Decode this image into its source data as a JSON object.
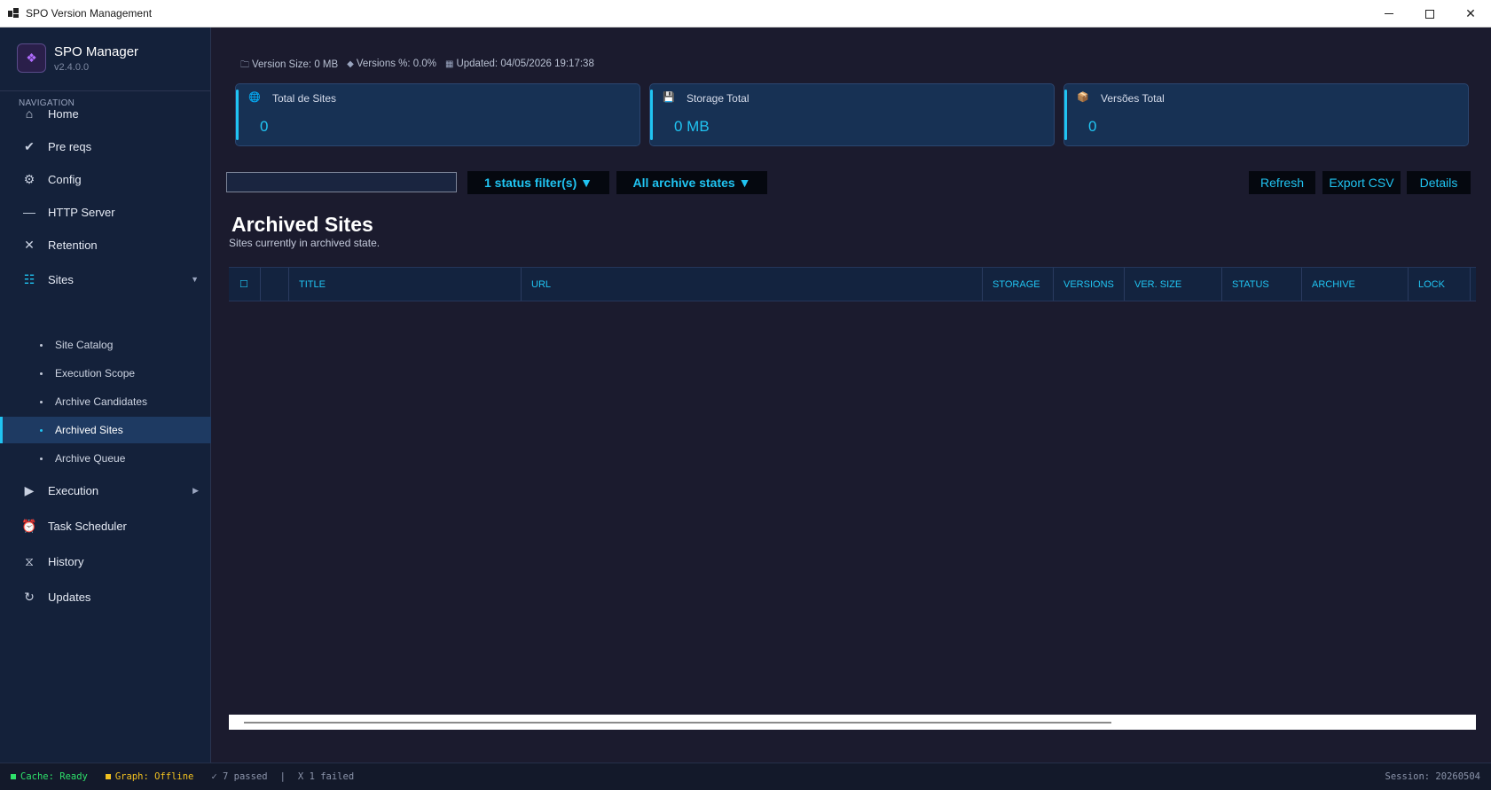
{
  "window": {
    "title": "SPO Version Management",
    "minimize": "—",
    "maximize": "☐",
    "close": "✕"
  },
  "brand": {
    "name": "SPO Manager",
    "version": "v2.4.0.0",
    "logo_icon": "diamond-icon"
  },
  "sidebar": {
    "heading": "NAVIGATION",
    "items": [
      {
        "label": "Home",
        "icon": "home-icon",
        "glyph": "⌂"
      },
      {
        "label": "Pre reqs",
        "icon": "check-icon",
        "glyph": "✔"
      },
      {
        "label": "Config",
        "icon": "gear-icon",
        "glyph": "⚙"
      },
      {
        "label": "HTTP Server",
        "icon": "dash-icon",
        "glyph": "—"
      },
      {
        "label": "Retention",
        "icon": "close-icon",
        "glyph": "✕"
      },
      {
        "label": "Sites",
        "icon": "list-icon",
        "glyph": "☷",
        "arrow": "▼"
      },
      {
        "label": "Execution",
        "icon": "play-icon",
        "glyph": "▶",
        "arrow": "▶"
      },
      {
        "label": "Task Scheduler",
        "icon": "alarm-icon",
        "glyph": "⏰"
      },
      {
        "label": "History",
        "icon": "hourglass-icon",
        "glyph": "⧖"
      },
      {
        "label": "Updates",
        "icon": "refresh-icon",
        "glyph": "↻"
      }
    ],
    "sites_subitems": [
      {
        "label": "Site Catalog"
      },
      {
        "label": "Execution Scope"
      },
      {
        "label": "Archive Candidates"
      },
      {
        "label": "Archived Sites",
        "active": true
      },
      {
        "label": "Archive Queue"
      }
    ]
  },
  "meta": {
    "version_size": "Version Size: 0 MB",
    "versions_pct": "Versions %: 0.0%",
    "updated": "Updated: 04/05/2026 19:17:38"
  },
  "cards": [
    {
      "label": "Total de Sites",
      "value": "0",
      "icon": "globe-icon",
      "glyph": "🌐"
    },
    {
      "label": "Storage Total",
      "value": "0 MB",
      "icon": "save-icon",
      "glyph": "💾"
    },
    {
      "label": "Versões Total",
      "value": "0",
      "icon": "box-icon",
      "glyph": "📦"
    }
  ],
  "toolbar": {
    "search_placeholder": "",
    "status_filter": "1 status filter(s) ▼",
    "archive_filter": "All archive states ▼",
    "refresh": "Refresh",
    "export_csv": "Export CSV",
    "details": "Details"
  },
  "page": {
    "title": "Archived Sites",
    "subtitle": "Sites currently in archived state."
  },
  "table": {
    "columns": [
      "☐",
      "",
      "TITLE",
      "URL",
      "STORAGE",
      "VERSIONS",
      "VER. SIZE",
      "STATUS",
      "ARCHIVE",
      "LOCK"
    ],
    "rows": []
  },
  "statusbar": {
    "cache": "Cache: Ready",
    "graph": "Graph: Offline",
    "passed": "✓ 7 passed",
    "divider": "|",
    "failed": "X 1 failed",
    "session": "Session: 20260504",
    "colors": {
      "cache": "#2ee06a",
      "graph": "#f0c020",
      "muted": "#8b94aa"
    }
  },
  "colors": {
    "accent": "#20c4f2",
    "sidebar_bg": "#14213a",
    "main_bg": "#1b1b2e",
    "card_bg": "#173154"
  }
}
